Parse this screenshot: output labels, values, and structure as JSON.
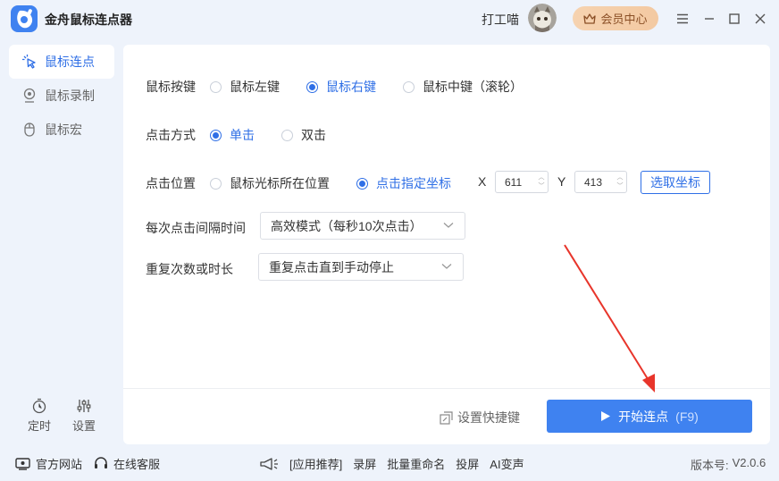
{
  "titlebar": {
    "app_title": "金舟鼠标连点器",
    "username": "打工喵",
    "vip_label": "会员中心"
  },
  "sidebar": {
    "items": [
      {
        "label": "鼠标连点",
        "active": true
      },
      {
        "label": "鼠标录制",
        "active": false
      },
      {
        "label": "鼠标宏",
        "active": false
      }
    ],
    "tools": [
      {
        "label": "定时"
      },
      {
        "label": "设置"
      }
    ]
  },
  "main": {
    "mouse_button": {
      "label": "鼠标按键",
      "options": [
        "鼠标左键",
        "鼠标右键",
        "鼠标中键（滚轮）"
      ],
      "selected": "鼠标右键"
    },
    "click_mode": {
      "label": "点击方式",
      "options": [
        "单击",
        "双击"
      ],
      "selected": "单击"
    },
    "click_position": {
      "label": "点击位置",
      "options": [
        "鼠标光标所在位置",
        "点击指定坐标"
      ],
      "selected": "点击指定坐标",
      "x_label": "X",
      "x_value": "611",
      "y_label": "Y",
      "y_value": "413",
      "pick_button": "选取坐标"
    },
    "interval": {
      "label": "每次点击间隔时间",
      "value": "高效模式（每秒10次点击）"
    },
    "repeat": {
      "label": "重复次数或时长",
      "value": "重复点击直到手动停止"
    },
    "shortcut_link": "设置快捷键",
    "start_button": {
      "label": "开始连点",
      "hotkey": "(F9)"
    }
  },
  "footer": {
    "website": "官方网站",
    "support": "在线客服",
    "recommend": "[应用推荐]",
    "apps": [
      "录屏",
      "批量重命名",
      "投屏",
      "AI变声"
    ],
    "version_label": "版本号:",
    "version": "V2.0.6"
  },
  "colors": {
    "accent": "#2f6fe6",
    "start_button": "#3f82f0",
    "vip_bg": "#f6d3b0",
    "annotation_arrow": "#e8352b"
  }
}
